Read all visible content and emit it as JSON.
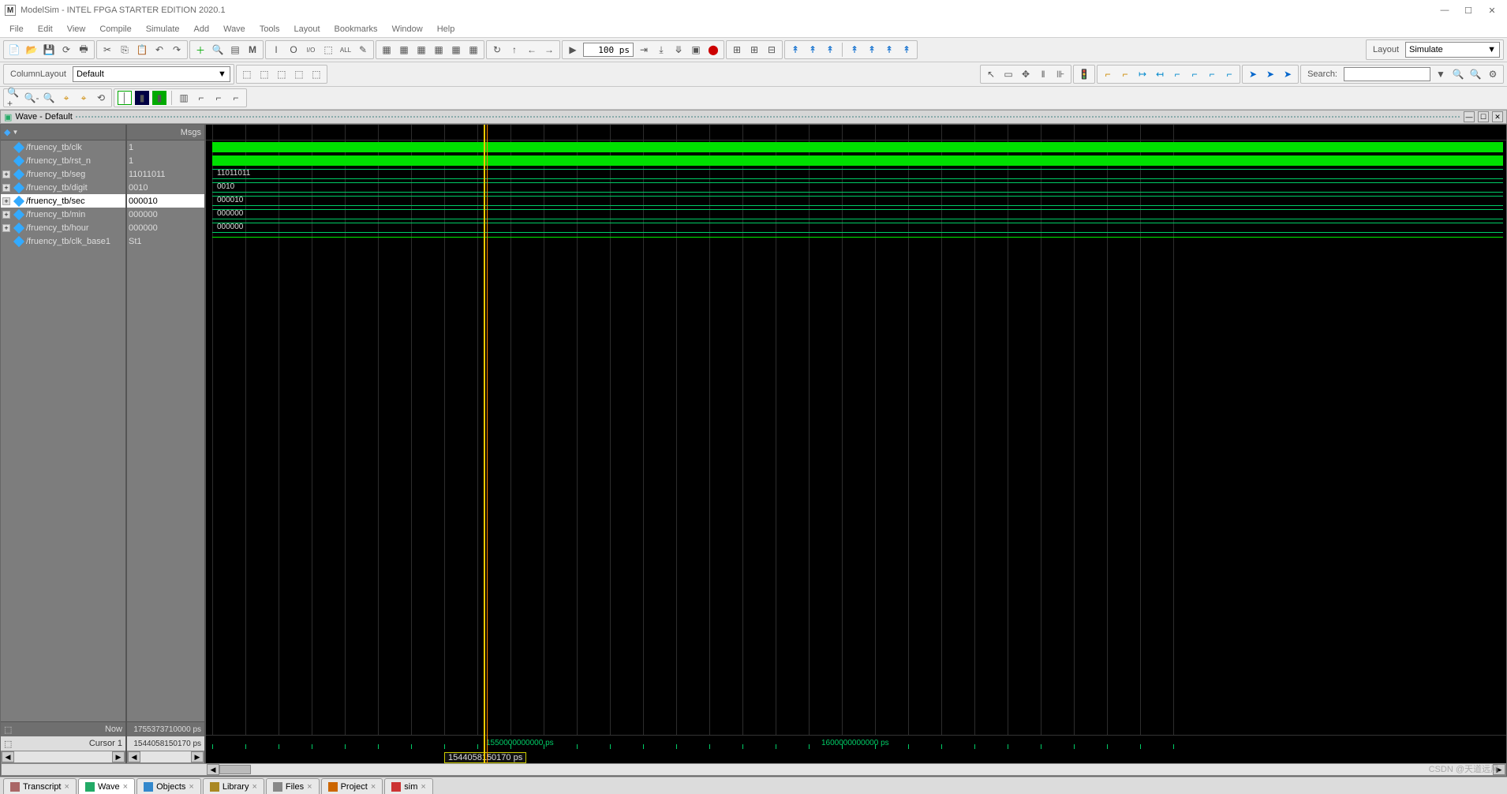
{
  "title": "ModelSim - INTEL FPGA STARTER EDITION 2020.1",
  "menus": [
    "File",
    "Edit",
    "View",
    "Compile",
    "Simulate",
    "Add",
    "Wave",
    "Tools",
    "Layout",
    "Bookmarks",
    "Window",
    "Help"
  ],
  "layout_label": "Layout",
  "layout_value": "Simulate",
  "columnlayout_label": "ColumnLayout",
  "columnlayout_value": "Default",
  "search_label": "Search:",
  "timebox_value": "100 ps",
  "wave_panel_title": "Wave - Default",
  "msgs_header": "Msgs",
  "signals": [
    {
      "exp": "",
      "name": "/fruency_tb/clk",
      "msg": "1",
      "kind": "bit-high"
    },
    {
      "exp": "",
      "name": "/fruency_tb/rst_n",
      "msg": "1",
      "kind": "bit-high"
    },
    {
      "exp": "+",
      "name": "/fruency_tb/seg",
      "msg": "11011011",
      "kind": "bus",
      "bus": "11011011"
    },
    {
      "exp": "+",
      "name": "/fruency_tb/digit",
      "msg": "0010",
      "kind": "bus",
      "bus": "0010"
    },
    {
      "exp": "+",
      "name": "/fruency_tb/sec",
      "msg": "000010",
      "kind": "bus",
      "bus": "000010",
      "selected": true
    },
    {
      "exp": "+",
      "name": "/fruency_tb/min",
      "msg": "000000",
      "kind": "bus",
      "bus": "000000"
    },
    {
      "exp": "+",
      "name": "/fruency_tb/hour",
      "msg": "000000",
      "kind": "bus",
      "bus": "000000"
    },
    {
      "exp": "",
      "name": "/fruency_tb/clk_base1",
      "msg": "St1",
      "kind": "line"
    }
  ],
  "now_label": "Now",
  "now_value": "1755373710000 ps",
  "cursor_label": "Cursor 1",
  "cursor_value": "1544058150170 ps",
  "cursor_box_value": "1544058150170 ps",
  "ruler_ticks": [
    {
      "pos": 355,
      "label": "1550000000000 ps"
    },
    {
      "pos": 780,
      "label": "1600000000000 ps"
    }
  ],
  "cursor_pixel": 352,
  "tabs": [
    {
      "label": "Transcript",
      "icon": "#a66"
    },
    {
      "label": "Wave",
      "icon": "#2a6",
      "active": true
    },
    {
      "label": "Objects",
      "icon": "#38c"
    },
    {
      "label": "Library",
      "icon": "#a82"
    },
    {
      "label": "Files",
      "icon": "#888"
    },
    {
      "label": "Project",
      "icon": "#c60"
    },
    {
      "label": "sim",
      "icon": "#c33"
    }
  ],
  "watermark": "CSDN @天道远风"
}
